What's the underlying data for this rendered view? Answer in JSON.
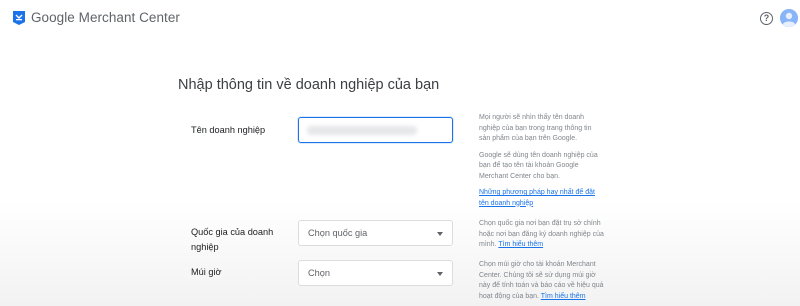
{
  "header": {
    "brand": "Google",
    "product": "Merchant Center",
    "help_icon": "help-circle-icon",
    "avatar_icon": "account-avatar-icon"
  },
  "main": {
    "title": "Nhập thông tin về doanh nghiệp của bạn",
    "fields": [
      {
        "label": "Tên doanh nghiệp",
        "value": ""
      },
      {
        "label_line1": "Quốc gia của doanh",
        "label_line2": "nghiệp",
        "value": "Chọn quốc gia"
      },
      {
        "label": "Múi giờ",
        "value": "Chọn"
      }
    ],
    "help": {
      "business_p1": "Mọi người sẽ nhìn thấy tên doanh nghiệp của bạn trong trang thông tin sản phẩm của bạn trên Google.",
      "business_p2": "Google sẽ dùng tên doanh nghiệp của bạn để tạo tên tài khoản Google Merchant Center cho bạn.",
      "business_link": "Những phương pháp hay nhất để đặt tên doanh nghiệp",
      "country_text": "Chọn quốc gia nơi bạn đặt trụ sở chính hoặc nơi bạn đăng ký doanh nghiệp của mình.",
      "country_link": "Tìm hiểu thêm",
      "timezone_text": "Chọn múi giờ cho tài khoản Merchant Center. Chúng tôi sẽ sử dụng múi giờ này để tính toán và báo cáo về hiệu quả hoạt động của bạn.",
      "timezone_link": "Tìm hiểu thêm"
    }
  },
  "colors": {
    "accent": "#1a73e8",
    "border": "#dadce0",
    "muted_text": "#80868b"
  }
}
